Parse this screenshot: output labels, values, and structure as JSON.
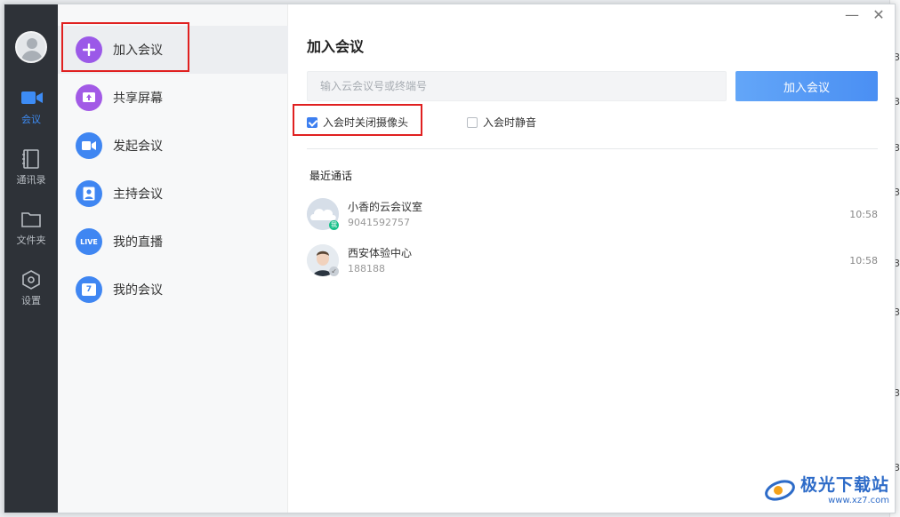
{
  "rail": {
    "items": [
      {
        "label": "会议",
        "icon": "video-camera-icon",
        "active": true
      },
      {
        "label": "通讯录",
        "icon": "contacts-book-icon"
      },
      {
        "label": "文件夹",
        "icon": "folder-icon"
      },
      {
        "label": "设置",
        "icon": "settings-hexagon-icon"
      }
    ]
  },
  "menu": {
    "items": [
      {
        "label": "加入会议",
        "icon": "plus-icon",
        "color": "#9b59e8",
        "active": true
      },
      {
        "label": "共享屏幕",
        "icon": "share-screen-icon",
        "color": "#a25ae6"
      },
      {
        "label": "发起会议",
        "icon": "video-icon",
        "color": "#3f86f2"
      },
      {
        "label": "主持会议",
        "icon": "host-icon",
        "color": "#3f86f2"
      },
      {
        "label": "我的直播",
        "icon": "live-icon",
        "color": "#3f86f2",
        "badge": "LIVE"
      },
      {
        "label": "我的会议",
        "icon": "calendar-icon",
        "color": "#3f86f2",
        "badge": "7"
      }
    ]
  },
  "main": {
    "title": "加入会议",
    "input_placeholder": "输入云会议号或终端号",
    "join_label": "加入会议",
    "options": [
      {
        "label": "入会时关闭摄像头",
        "checked": true
      },
      {
        "label": "入会时静音",
        "checked": false
      }
    ],
    "recent_title": "最近通话",
    "recent": [
      {
        "name": "小香的云会议室",
        "id": "9041592757",
        "time": "10:58",
        "badge": "我"
      },
      {
        "name": "西安体验中心",
        "id": "188188",
        "time": "10:58",
        "badge": "↙"
      }
    ]
  },
  "watermark": {
    "line1": "极光下载站",
    "line2": "www.xz7.com"
  },
  "backdrop_marks": [
    "3",
    "3",
    "3",
    "3",
    "3",
    "3",
    "3",
    "3"
  ],
  "colors": {
    "accent": "#3d8cf5",
    "highlight_box": "#e02020"
  }
}
